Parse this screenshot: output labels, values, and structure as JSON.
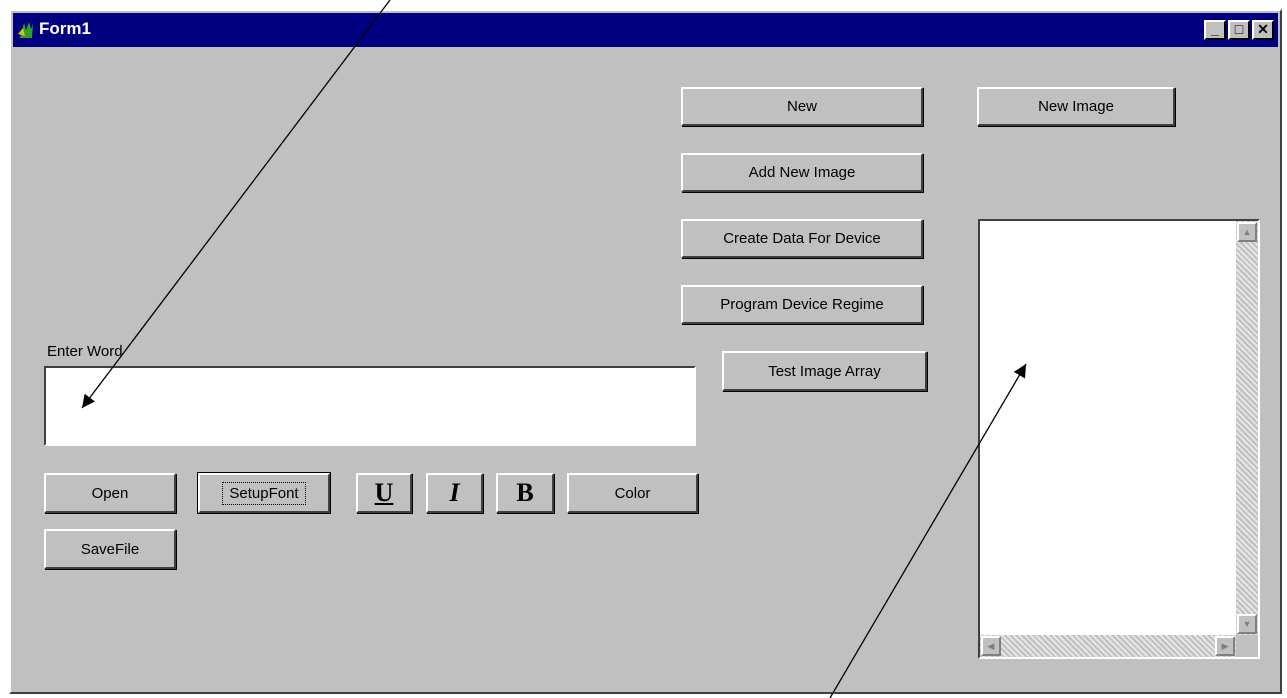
{
  "window": {
    "title": "Form1",
    "minimize_glyph": "_",
    "maximize_glyph": "□",
    "close_glyph": "✕"
  },
  "buttons": {
    "new": "New",
    "new_image": "New Image",
    "add_new_image": "Add New Image",
    "create_data_for_device": "Create Data For Device",
    "program_device_regime": "Program Device Regime",
    "test_image_array": "Test Image Array",
    "open": "Open",
    "setup_font": "SetupFont",
    "underline": "U",
    "italic": "I",
    "bold": "B",
    "color": "Color",
    "save_file": "SaveFile"
  },
  "word_input": {
    "label": "Enter Word",
    "value": ""
  },
  "scrollbar_glyphs": {
    "up": "▲",
    "down": "▼",
    "left": "◀",
    "right": "▶"
  },
  "colors": {
    "titlebar": "#000080",
    "face": "#c0c0c0"
  }
}
